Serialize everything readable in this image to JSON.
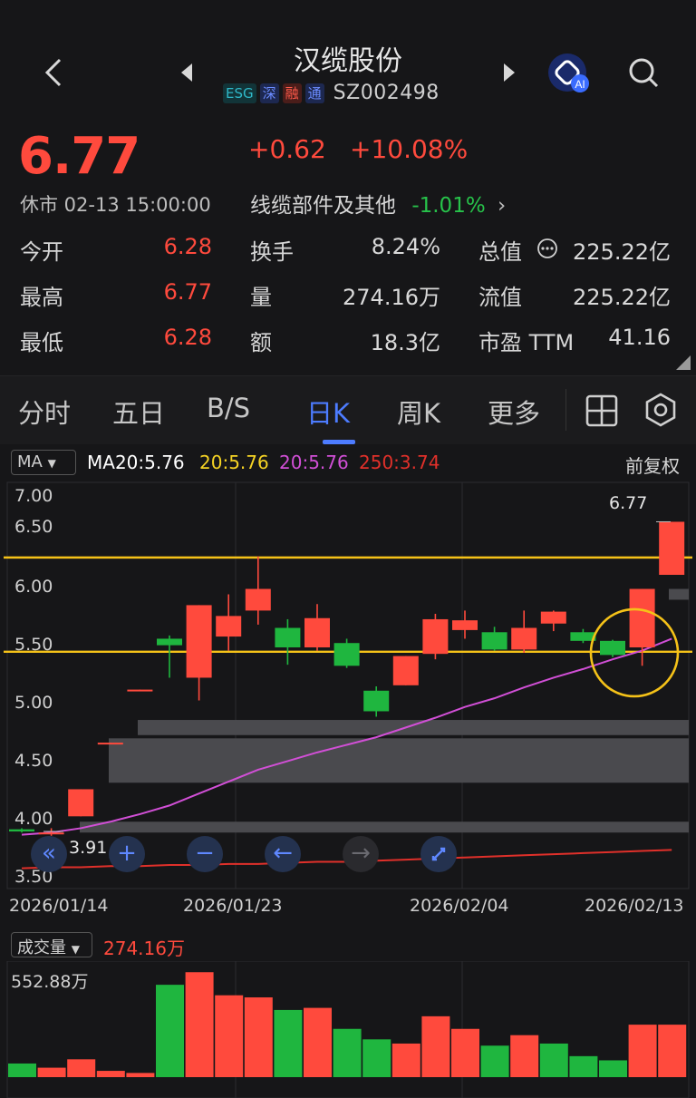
{
  "header": {
    "title": "汉缆股份",
    "tags": [
      "ESG",
      "深",
      "融",
      "通"
    ],
    "code": "SZ002498"
  },
  "quote": {
    "price": "6.77",
    "change": "+0.62",
    "change_pct": "+10.08%",
    "status": "休市 02-13 15:00:00",
    "sector": "线缆部件及其他",
    "sector_pct": "-1.01%",
    "stats": [
      {
        "label": "今开",
        "value": "6.28",
        "color": "red"
      },
      {
        "label": "换手",
        "value": "8.24%",
        "color": "white"
      },
      {
        "label": "总值",
        "value": "225.22亿",
        "color": "white"
      },
      {
        "label": "最高",
        "value": "6.77",
        "color": "red"
      },
      {
        "label": "量",
        "value": "274.16万",
        "color": "white"
      },
      {
        "label": "流值",
        "value": "225.22亿",
        "color": "white"
      },
      {
        "label": "最低",
        "value": "6.28",
        "color": "red"
      },
      {
        "label": "额",
        "value": "18.3亿",
        "color": "white"
      },
      {
        "label": "市盈 TTM",
        "value": "41.16",
        "color": "white"
      }
    ]
  },
  "tabs": [
    "分时",
    "五日",
    "B/S",
    "日K",
    "周K",
    "更多"
  ],
  "active_tab": "日K",
  "chart": {
    "ma_selector": "MA",
    "ma_legend": [
      {
        "text": "MA20:5.76",
        "color": "#ffffff"
      },
      {
        "text": "20:5.76",
        "color": "#f5d324"
      },
      {
        "text": "20:5.76",
        "color": "#d14fd6"
      },
      {
        "text": "250:3.74",
        "color": "#e0302a"
      }
    ],
    "adjust_label": "前复权",
    "y_ticks": [
      "7.00",
      "6.50",
      "6.00",
      "5.50",
      "5.00",
      "4.50",
      "4.00",
      "3.50"
    ],
    "high_marker": "6.77",
    "low_marker": "3.91",
    "x_ticks": [
      "2026/01/14",
      "2026/01/23",
      "2026/02/04",
      "2026/02/13"
    ],
    "volume_selector": "成交量",
    "volume_value": "274.16万",
    "volume_max": "552.88万",
    "colors": {
      "up": "#ff4a3d",
      "down": "#1fb63f",
      "support_line": "#f5c218",
      "circle": "#f5c218"
    }
  },
  "chart_data": {
    "type": "candlestick",
    "support_levels": [
      6.44,
      5.57
    ],
    "candles": [
      {
        "o": 3.93,
        "c": 3.91,
        "h": 3.94,
        "l": 3.9
      },
      {
        "o": 3.89,
        "c": 3.9,
        "h": 3.94,
        "l": 3.87
      },
      {
        "o": 4.05,
        "c": 4.3,
        "h": 4.3,
        "l": 4.05
      },
      {
        "o": 4.72,
        "c": 4.73,
        "h": 4.73,
        "l": 4.72
      },
      {
        "o": 5.21,
        "c": 5.22,
        "h": 5.22,
        "l": 5.21
      },
      {
        "o": 5.69,
        "c": 5.63,
        "h": 5.72,
        "l": 5.33
      },
      {
        "o": 5.33,
        "c": 6.0,
        "h": 6.0,
        "l": 5.12
      },
      {
        "o": 5.71,
        "c": 5.9,
        "h": 6.1,
        "l": 5.58
      },
      {
        "o": 5.95,
        "c": 6.15,
        "h": 6.45,
        "l": 5.82
      },
      {
        "o": 5.79,
        "c": 5.61,
        "h": 5.87,
        "l": 5.45
      },
      {
        "o": 5.61,
        "c": 5.88,
        "h": 6.01,
        "l": 5.58
      },
      {
        "o": 5.65,
        "c": 5.44,
        "h": 5.69,
        "l": 5.42
      },
      {
        "o": 5.21,
        "c": 5.02,
        "h": 5.25,
        "l": 4.97
      },
      {
        "o": 5.26,
        "c": 5.53,
        "h": 5.53,
        "l": 5.26
      },
      {
        "o": 5.55,
        "c": 5.87,
        "h": 5.92,
        "l": 5.5
      },
      {
        "o": 5.77,
        "c": 5.86,
        "h": 5.95,
        "l": 5.69
      },
      {
        "o": 5.75,
        "c": 5.59,
        "h": 5.8,
        "l": 5.58
      },
      {
        "o": 5.59,
        "c": 5.79,
        "h": 5.95,
        "l": 5.56
      },
      {
        "o": 5.83,
        "c": 5.94,
        "h": 5.95,
        "l": 5.76
      },
      {
        "o": 5.75,
        "c": 5.67,
        "h": 5.78,
        "l": 5.65
      },
      {
        "o": 5.67,
        "c": 5.54,
        "h": 5.68,
        "l": 5.52
      },
      {
        "o": 5.61,
        "c": 6.15,
        "h": 6.15,
        "l": 5.44
      },
      {
        "o": 6.28,
        "c": 6.77,
        "h": 6.77,
        "l": 6.28
      }
    ],
    "ma20": [
      3.88,
      3.9,
      3.94,
      4.0,
      4.07,
      4.15,
      4.26,
      4.37,
      4.48,
      4.56,
      4.64,
      4.71,
      4.78,
      4.87,
      4.96,
      5.06,
      5.14,
      5.24,
      5.33,
      5.41,
      5.5,
      5.58,
      5.69
    ],
    "ma250": [
      3.57,
      3.58,
      3.58,
      3.59,
      3.59,
      3.6,
      3.6,
      3.61,
      3.61,
      3.62,
      3.63,
      3.63,
      3.64,
      3.65,
      3.66,
      3.67,
      3.68,
      3.69,
      3.7,
      3.71,
      3.72,
      3.73,
      3.74
    ],
    "volume": [
      {
        "v": 0.65,
        "up": false
      },
      {
        "v": 0.45,
        "up": true
      },
      {
        "v": 0.85,
        "up": true
      },
      {
        "v": 0.3,
        "up": true
      },
      {
        "v": 0.2,
        "up": true
      },
      {
        "v": 4.4,
        "up": false
      },
      {
        "v": 5.0,
        "up": true
      },
      {
        "v": 3.9,
        "up": true
      },
      {
        "v": 3.8,
        "up": true
      },
      {
        "v": 3.2,
        "up": false
      },
      {
        "v": 3.3,
        "up": true
      },
      {
        "v": 2.3,
        "up": false
      },
      {
        "v": 1.8,
        "up": false
      },
      {
        "v": 1.6,
        "up": true
      },
      {
        "v": 2.9,
        "up": true
      },
      {
        "v": 2.3,
        "up": true
      },
      {
        "v": 1.5,
        "up": false
      },
      {
        "v": 2.0,
        "up": true
      },
      {
        "v": 1.6,
        "up": false
      },
      {
        "v": 1.0,
        "up": false
      },
      {
        "v": 0.8,
        "up": false
      },
      {
        "v": 2.5,
        "up": true
      },
      {
        "v": 2.5,
        "up": true
      }
    ]
  }
}
